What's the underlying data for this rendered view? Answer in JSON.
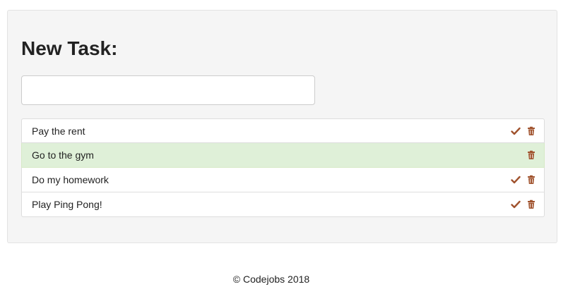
{
  "panel": {
    "title": "New Task:",
    "input": {
      "value": "",
      "placeholder": ""
    }
  },
  "tasks": [
    {
      "text": "Pay the rent",
      "done": false
    },
    {
      "text": "Go to the gym",
      "done": true
    },
    {
      "text": "Do my homework",
      "done": false
    },
    {
      "text": "Play Ping Pong!",
      "done": false
    }
  ],
  "icons": {
    "complete": "check-icon",
    "delete": "trash-icon"
  },
  "colors": {
    "icon": "#a0522d",
    "done_row": "#dff0d8",
    "panel_bg": "#f5f5f5"
  },
  "footer": {
    "text": "© Codejobs 2018"
  }
}
